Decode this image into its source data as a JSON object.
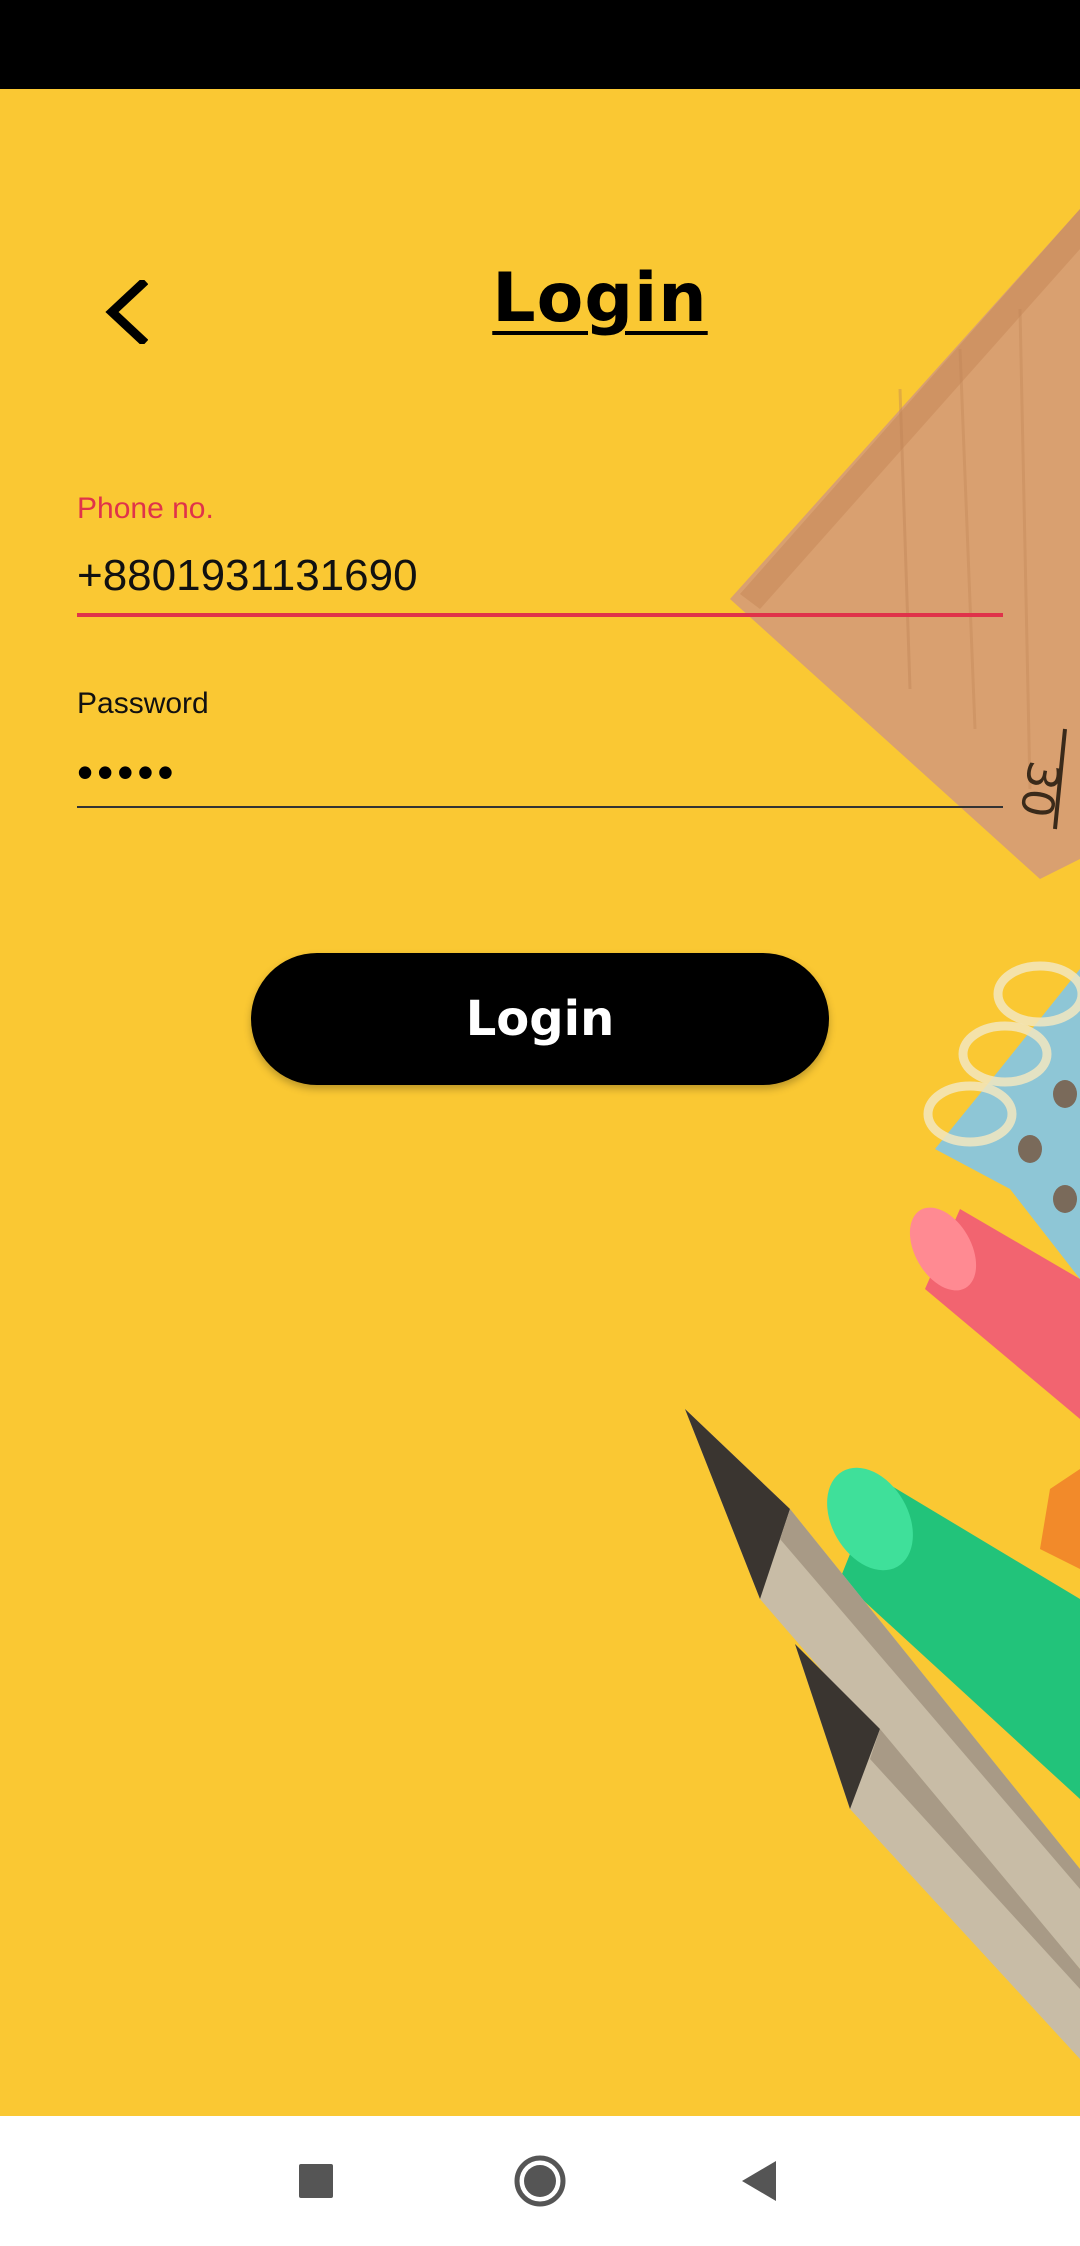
{
  "header": {
    "title": "Login",
    "back_icon": "chevron-left-icon"
  },
  "form": {
    "phone": {
      "label": "Phone no.",
      "value": "+8801931131690"
    },
    "password": {
      "label": "Password",
      "value": "•••••"
    },
    "submit_label": "Login"
  },
  "navigation_bar": {
    "recents_icon": "square-icon",
    "home_icon": "circle-icon",
    "back_icon": "triangle-back-icon"
  },
  "colors": {
    "background": "#FAC833",
    "accent_error": "#E0334A",
    "button": "#000000",
    "button_text": "#FFFFFF"
  },
  "decor": {
    "ruler_marking": "30"
  }
}
